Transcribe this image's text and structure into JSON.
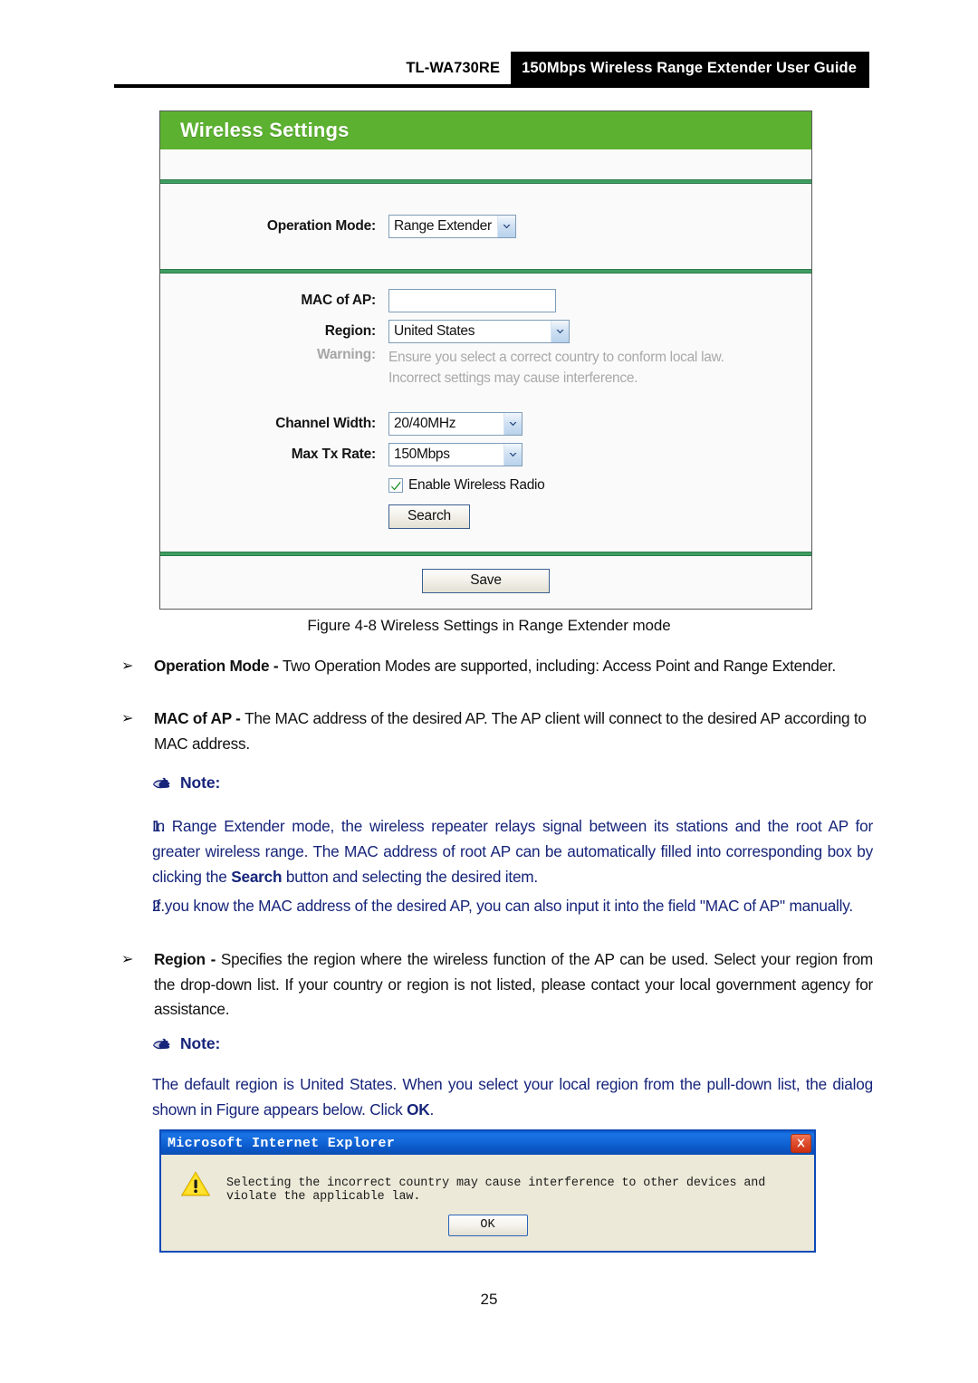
{
  "header": {
    "model": "TL-WA730RE",
    "title": "150Mbps Wireless Range Extender User Guide"
  },
  "router_ui": {
    "panel_title": "Wireless Settings",
    "accent_green": "#5CB130",
    "divider_green": "#3F9E62",
    "fields": {
      "operation_mode_label": "Operation Mode:",
      "operation_mode_value": "Range Extender",
      "mac_of_ap_label": "MAC of AP:",
      "mac_of_ap_value": "",
      "region_label": "Region:",
      "region_value": "United States",
      "warning_label": "Warning:",
      "warning_line1": "Ensure you select a correct country to conform local law.",
      "warning_line2": "Incorrect settings may cause interference.",
      "channel_width_label": "Channel Width:",
      "channel_width_value": "20/40MHz",
      "max_tx_rate_label": "Max Tx Rate:",
      "max_tx_rate_value": "150Mbps",
      "enable_wireless_radio_label": "Enable Wireless Radio",
      "enable_wireless_radio_checked": true,
      "search_button": "Search",
      "save_button": "Save"
    }
  },
  "figure_caption": "Figure 4-8 Wireless Settings in Range Extender mode",
  "bullets": [
    {
      "marker": "➢",
      "term": "Operation Mode - ",
      "text": "Two Operation Modes are supported, including: Access Point and Range Extender."
    },
    {
      "marker": "➢",
      "term": "MAC of AP - ",
      "text": "The MAC address of the desired AP. The AP client will connect to the desired AP according to MAC address."
    }
  ],
  "note1": {
    "icon": "pointing-hand-icon",
    "label": "Note:",
    "items": [
      {
        "num": "1.",
        "part1": "In Range Extender mode, the wireless repeater relays signal between its stations and the root AP for greater wireless range. The MAC address of root AP can be automatically filled into corresponding box by clicking the ",
        "bold": "Search",
        "part2": " button and selecting the desired item."
      },
      {
        "num": "2.",
        "part1": "If you know the MAC address of the desired AP, you can also input it into the field \"MAC of AP\" manually.",
        "bold": "",
        "part2": ""
      }
    ]
  },
  "bullet_region": {
    "marker": "➢",
    "term": "Region - ",
    "text": "Specifies the region where the wireless function of the AP can be used. Select your region from the drop-down list. If your country or region is not listed, please contact your local government agency for assistance."
  },
  "note2": {
    "icon": "pointing-hand-icon",
    "label": "Note:",
    "part1": "The default region is United States. When you select your local region from the pull-down list, the dialog shown in Figure appears below. Click ",
    "bold": "OK",
    "part2": "."
  },
  "ie_dialog": {
    "title": "Microsoft Internet Explorer",
    "close_icon": "close-icon",
    "warning_icon": "warning-triangle-icon",
    "message": "Selecting the incorrect country may cause interference to other devices and violate the applicable law.",
    "ok_button": "OK",
    "titlebar_color": "#1063D4",
    "body_color": "#ECE9D8"
  },
  "page_number": "25"
}
